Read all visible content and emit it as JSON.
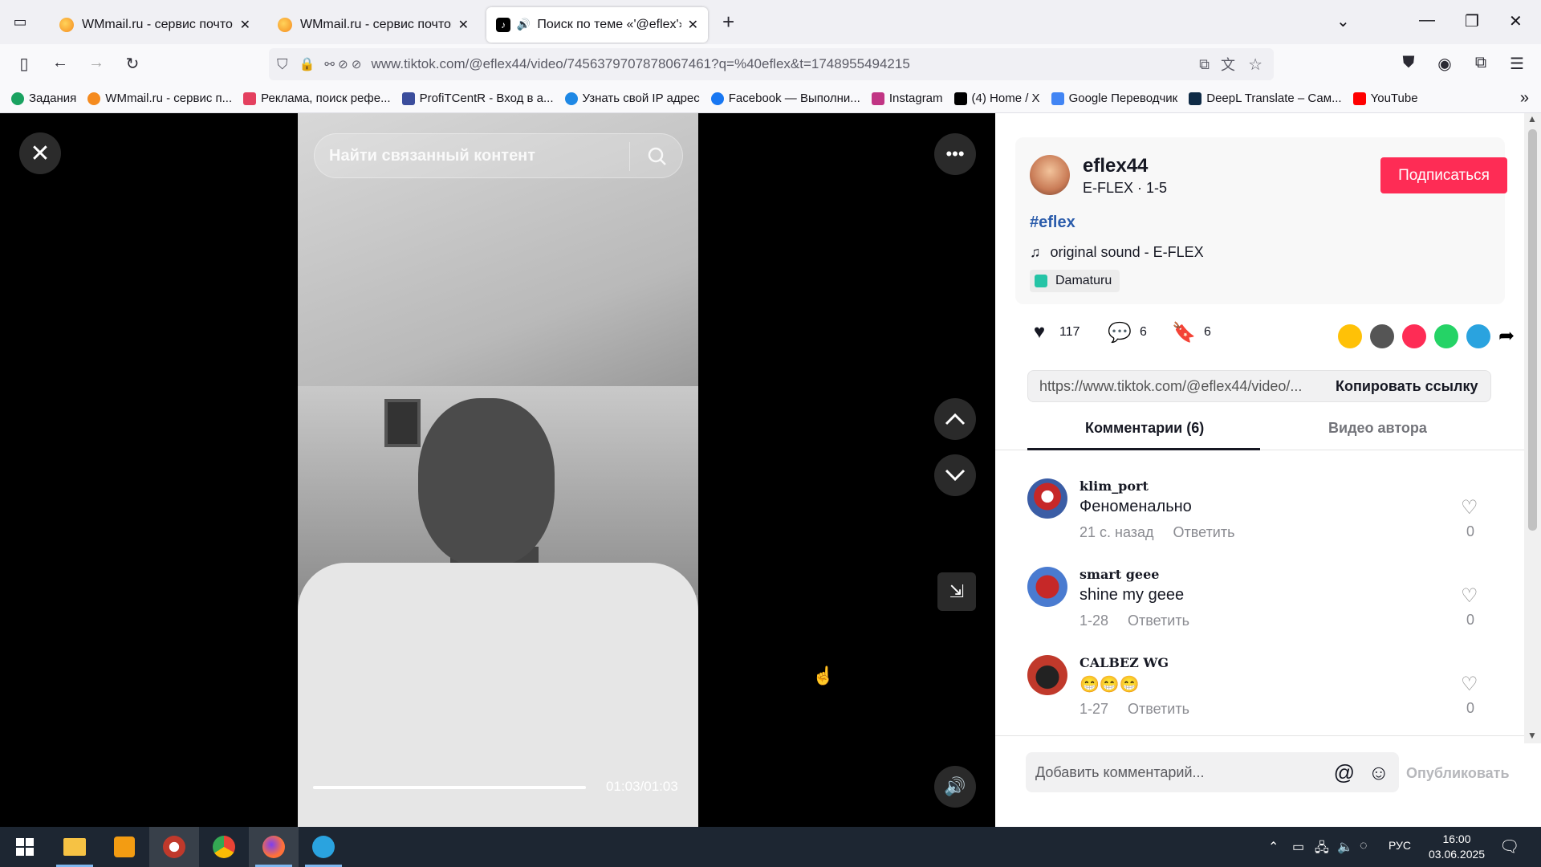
{
  "browser": {
    "tabs": [
      {
        "title": "WMmail.ru - сервис почтовых"
      },
      {
        "title": "WMmail.ru - сервис почтовых"
      },
      {
        "title": "Поиск по теме «'@eflex'» в"
      }
    ],
    "url": "www.tiktok.com/@eflex44/video/7456379707878067461?q=%40eflex&t=1748955494215",
    "bookmarks": [
      "Задания",
      "WMmail.ru - сервис п...",
      "Реклама, поиск рефе...",
      "ProfiTCentR - Вход в а...",
      "Узнать свой IP адрес",
      "Facebook — Выполни...",
      "Instagram",
      "(4) Home / X",
      "Google Переводчик",
      "DeepL Translate – Сам...",
      "YouTube"
    ],
    "bookmark_colors": [
      "#1aa260",
      "#f58b1f",
      "#e4405f",
      "#3b4d9c",
      "#1e88e5",
      "#1877f2",
      "#c13584",
      "#000000",
      "#4285f4",
      "#0f2b46",
      "#ff0000"
    ]
  },
  "video": {
    "search_placeholder": "Найти связанный контент",
    "timecode": "01:03/01:03",
    "progress": 1.0
  },
  "author": {
    "username": "eflex44",
    "subtitle": "E-FLEX · 1-5",
    "follow_label": "Подписаться",
    "hashtag": "#eflex",
    "sound": "original sound - E-FLEX",
    "location": "Damaturu"
  },
  "stats": {
    "likes": "117",
    "comments": "6",
    "saves": "6"
  },
  "share": {
    "link": "https://www.tiktok.com/@eflex44/video/...",
    "copy_label": "Копировать ссылку",
    "icons": [
      "repost-icon",
      "embed-icon",
      "send-icon",
      "whatsapp-icon",
      "telegram-icon",
      "share-arrow-icon"
    ]
  },
  "panel_tabs": {
    "comments": "Комментарии (6)",
    "author_videos": "Видео автора"
  },
  "comments": [
    {
      "user": "klim_port",
      "text": "Феноменально",
      "time": "21 с. назад",
      "reply": "Ответить",
      "likes": "0"
    },
    {
      "user": "smart geee",
      "text": "shine my geee",
      "time": "1-28",
      "reply": "Ответить",
      "likes": "0"
    },
    {
      "user": "CALBEZ WG",
      "text": "😁😁😁",
      "time": "1-27",
      "reply": "Ответить",
      "likes": "0"
    }
  ],
  "composer": {
    "placeholder": "Добавить комментарий...",
    "post_label": "Опубликовать"
  },
  "taskbar": {
    "lang": "РУС",
    "time": "16:00",
    "date": "03.06.2025"
  },
  "colors": {
    "accent": "#fe2c55",
    "hashtag": "#2b5cab"
  }
}
